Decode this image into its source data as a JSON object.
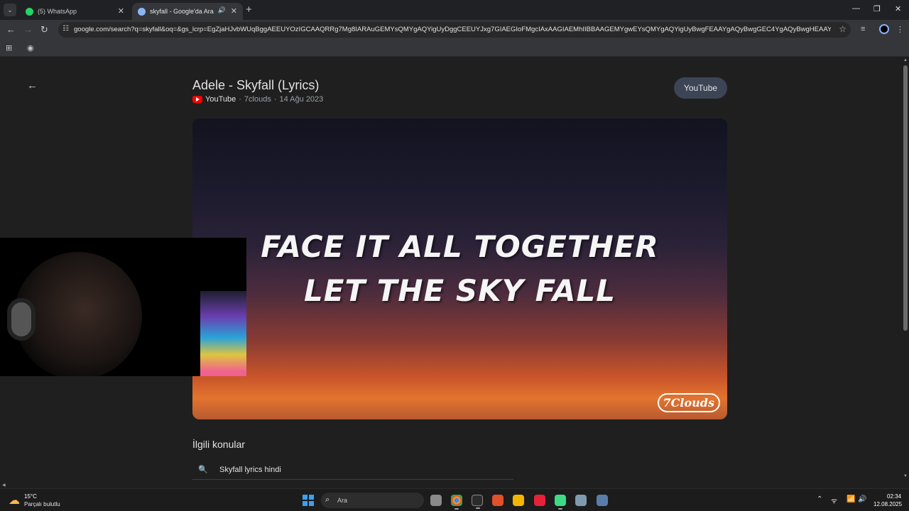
{
  "browser": {
    "tabs": [
      {
        "title": "(5) WhatsApp",
        "active": false,
        "favicon_color": "#25d366"
      },
      {
        "title": "skyfall - Google'da Ara",
        "active": true,
        "favicon_color": "#8ab4f8"
      }
    ],
    "address": "google.com/search?q=skyfall&oq=&gs_lcrp=EgZjaHJvbWUqBggAEEUYOzIGCAAQRRg7Mg8IARAuGEMYsQMYgAQYigUyDggCEEUYJxg7GIAEGIoFMgcIAxAAGIAEMhIIBBAAGEMYgwEYsQMYgAQYigUyBwgFEAAYgAQyBwgGEC4YgAQyBwgHEAAYgAQyBwgIEAAYg..."
  },
  "page": {
    "video_title": "Adele - Skyfall (Lyrics)",
    "source": "YouTube",
    "channel": "7clouds",
    "date": "14 Ağu 2023",
    "separator": "·",
    "youtube_button": "YouTube",
    "lyrics_line1": "FACE IT ALL TOGETHER",
    "lyrics_line2": "LET THE SKY FALL",
    "brand": "7Clouds",
    "related_heading": "İlgili konular",
    "related_items": [
      "Skyfall lyrics hindi"
    ]
  },
  "taskbar": {
    "weather_temp": "15°C",
    "weather_desc": "Parçalı bulutlu",
    "search_placeholder": "Ara",
    "time": "02:34",
    "date": "12.08.2025"
  },
  "colors": {
    "accent": "#8ab4f8",
    "youtube_red": "#ff0000"
  }
}
